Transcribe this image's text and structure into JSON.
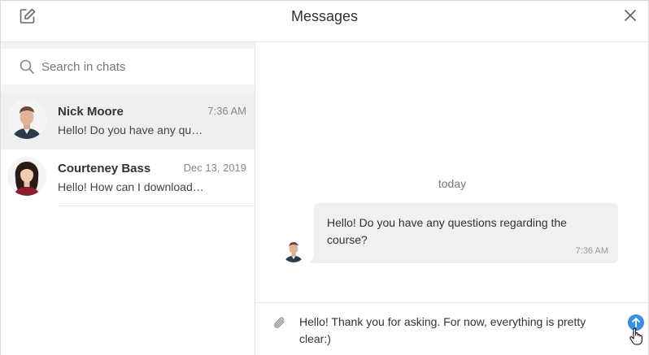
{
  "header": {
    "title": "Messages",
    "compose_icon": "compose-icon",
    "close_icon": "close-icon"
  },
  "search": {
    "placeholder": "Search in chats",
    "icon": "search-icon"
  },
  "chats": [
    {
      "name": "Nick Moore",
      "time": "7:36 AM",
      "preview": "Hello! Do you have any questions regarding the course?",
      "active": true
    },
    {
      "name": "Courteney Bass",
      "time": "Dec 13, 2019",
      "preview": "Hello! How can I download the materials?",
      "active": false
    }
  ],
  "conversation": {
    "day_label": "today",
    "messages": [
      {
        "text": "Hello! Do you have any questions regarding the course?",
        "time": "7:36 AM"
      }
    ]
  },
  "composer": {
    "value": "Hello! Thank you for asking. For now, everything is pretty clear:)",
    "attach_icon": "paperclip-icon",
    "send_icon": "send-arrow-icon"
  },
  "colors": {
    "accent": "#3a8de0",
    "active_chat_bg": "#efefef",
    "bubble_bg": "#f0f0f0"
  }
}
